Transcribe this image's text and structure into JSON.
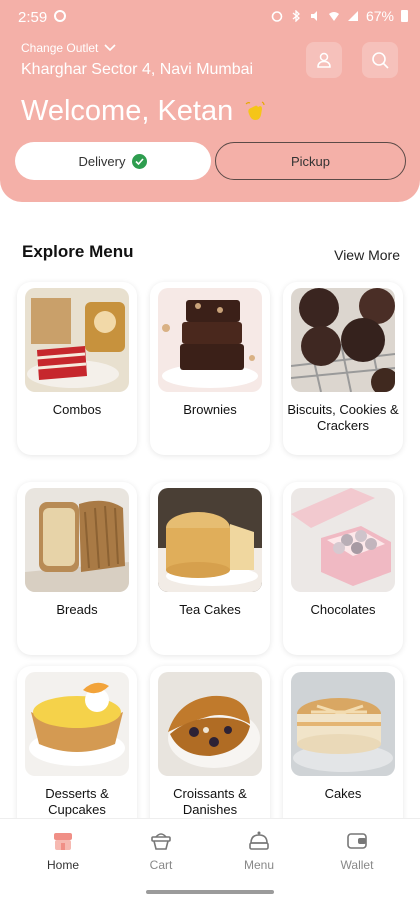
{
  "status_bar": {
    "time": "2:59",
    "battery": "67%"
  },
  "header": {
    "change_outlet": "Change Outlet",
    "address": "Kharghar Sector 4, Navi Mumbai",
    "welcome": "Welcome, Ketan",
    "background_color": "#f4b0a8"
  },
  "order_type": {
    "delivery_label": "Delivery",
    "pickup_label": "Pickup",
    "selected": "Delivery"
  },
  "menu": {
    "title": "Explore Menu",
    "view_more": "View More",
    "categories": [
      {
        "label": "Combos",
        "icon": "combos-photo"
      },
      {
        "label": "Brownies",
        "icon": "brownies-photo"
      },
      {
        "label": "Biscuits, Cookies & Crackers",
        "icon": "cookies-photo"
      },
      {
        "label": "Breads",
        "icon": "bread-photo"
      },
      {
        "label": "Tea Cakes",
        "icon": "tea-cake-photo"
      },
      {
        "label": "Chocolates",
        "icon": "chocolates-photo"
      },
      {
        "label": "Desserts & Cupcakes",
        "icon": "dessert-photo"
      },
      {
        "label": "Croissants & Danishes",
        "icon": "croissant-photo"
      },
      {
        "label": "Cakes",
        "icon": "cake-photo"
      }
    ]
  },
  "bottom_nav": {
    "items": [
      {
        "label": "Home",
        "icon": "home-store-icon",
        "active": true
      },
      {
        "label": "Cart",
        "icon": "basket-icon",
        "active": false
      },
      {
        "label": "Menu",
        "icon": "menu-icon",
        "active": false
      },
      {
        "label": "Wallet",
        "icon": "wallet-icon",
        "active": false
      }
    ]
  },
  "colors": {
    "accent": "#f4b0a8",
    "check_green": "#2e9d4f"
  }
}
